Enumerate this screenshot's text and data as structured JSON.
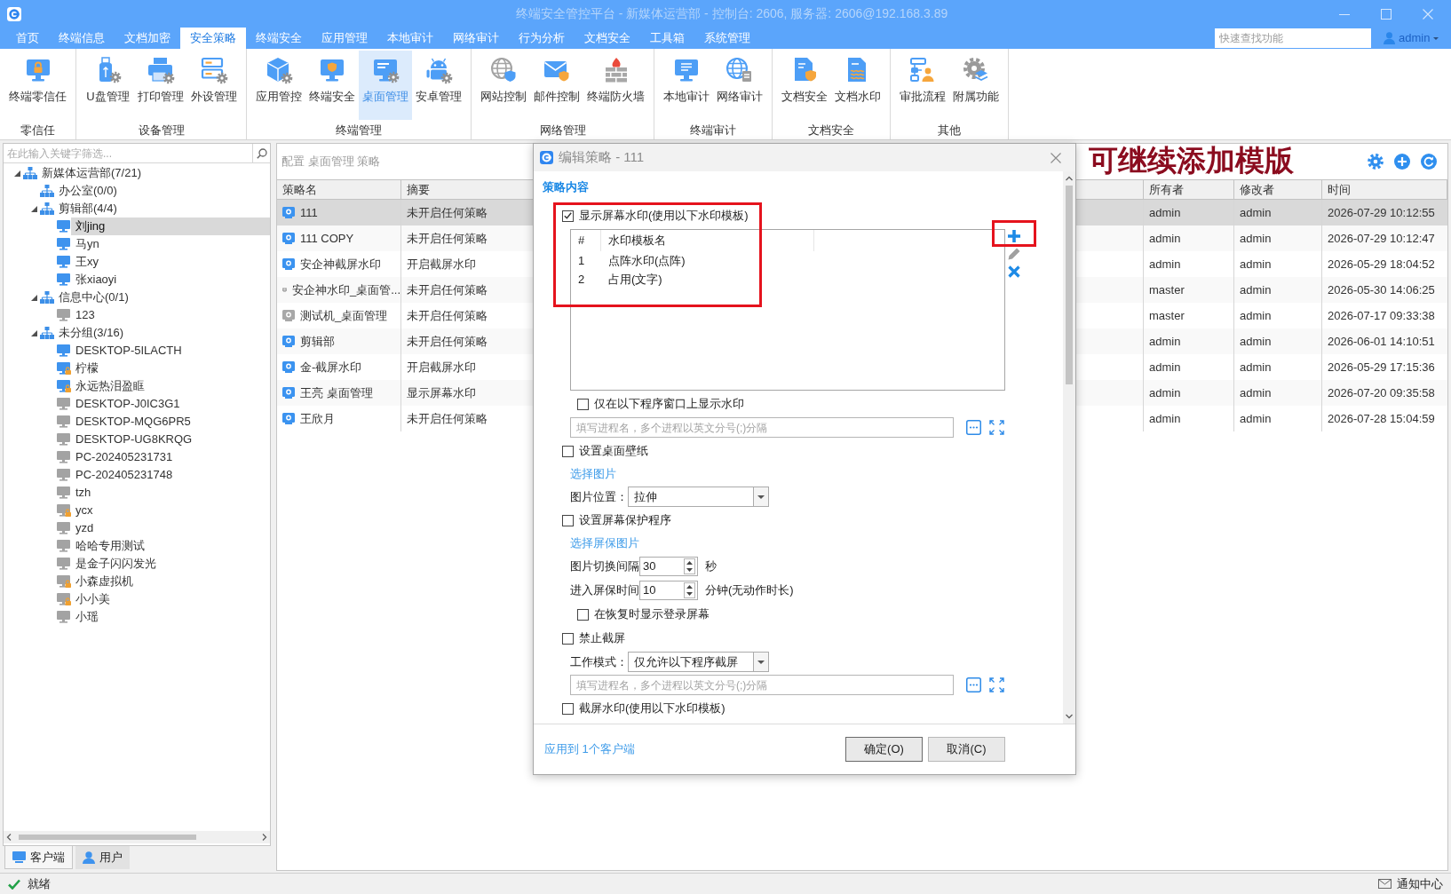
{
  "window": {
    "title": "终端安全管控平台 - 新媒体运营部 - 控制台: 2606, 服务器: 2606@192.168.3.89"
  },
  "menu_tabs": [
    {
      "label": "首页",
      "selected": false
    },
    {
      "label": "终端信息",
      "selected": false
    },
    {
      "label": "文档加密",
      "selected": false
    },
    {
      "label": "安全策略",
      "selected": true
    },
    {
      "label": "终端安全",
      "selected": false
    },
    {
      "label": "应用管理",
      "selected": false
    },
    {
      "label": "本地审计",
      "selected": false
    },
    {
      "label": "网络审计",
      "selected": false
    },
    {
      "label": "行为分析",
      "selected": false
    },
    {
      "label": "文档安全",
      "selected": false
    },
    {
      "label": "工具箱",
      "selected": false
    },
    {
      "label": "系统管理",
      "selected": false
    }
  ],
  "quick_search": {
    "placeholder": "快速查找功能"
  },
  "user": {
    "name": "admin"
  },
  "ribbon": {
    "groups": [
      {
        "label": "零信任",
        "items": [
          {
            "label": "终端零信任",
            "selected": false
          }
        ]
      },
      {
        "label": "设备管理",
        "items": [
          {
            "label": "U盘管理",
            "selected": false
          },
          {
            "label": "打印管理",
            "selected": false
          },
          {
            "label": "外设管理",
            "selected": false
          }
        ]
      },
      {
        "label": "终端管理",
        "items": [
          {
            "label": "应用管控",
            "selected": false
          },
          {
            "label": "终端安全",
            "selected": false
          },
          {
            "label": "桌面管理",
            "selected": true
          },
          {
            "label": "安卓管理",
            "selected": false
          }
        ]
      },
      {
        "label": "网络管理",
        "items": [
          {
            "label": "网站控制",
            "selected": false
          },
          {
            "label": "邮件控制",
            "selected": false
          },
          {
            "label": "终端防火墙",
            "selected": false
          }
        ]
      },
      {
        "label": "终端审计",
        "items": [
          {
            "label": "本地审计",
            "selected": false
          },
          {
            "label": "网络审计",
            "selected": false
          }
        ]
      },
      {
        "label": "文档安全",
        "items": [
          {
            "label": "文档安全",
            "selected": false
          },
          {
            "label": "文档水印",
            "selected": false
          }
        ]
      },
      {
        "label": "其他",
        "items": [
          {
            "label": "审批流程",
            "selected": false
          },
          {
            "label": "附属功能",
            "selected": false
          }
        ]
      }
    ]
  },
  "tree_filter": {
    "placeholder": "在此输入关键字筛选..."
  },
  "tree": [
    {
      "kind": "group",
      "label": "新媒体运营部(7/21)",
      "expanded": true,
      "selected": false,
      "children": [
        {
          "kind": "group",
          "label": "办公室(0/0)",
          "selected": false
        },
        {
          "kind": "group",
          "label": "剪辑部(4/4)",
          "expanded": true,
          "selected": false,
          "children": [
            {
              "kind": "client",
              "label": "刘jing",
              "online": true,
              "locked": false,
              "selected": true
            },
            {
              "kind": "client",
              "label": "马yn",
              "online": true,
              "locked": false,
              "selected": false
            },
            {
              "kind": "client",
              "label": "王xy",
              "online": true,
              "locked": false,
              "selected": false
            },
            {
              "kind": "client",
              "label": "张xiaoyi",
              "online": true,
              "locked": false,
              "selected": false
            }
          ]
        },
        {
          "kind": "group",
          "label": "信息中心(0/1)",
          "expanded": true,
          "selected": false,
          "children": [
            {
              "kind": "client",
              "label": "123",
              "online": false,
              "locked": false,
              "selected": false
            }
          ]
        },
        {
          "kind": "group",
          "label": "未分组(3/16)",
          "expanded": true,
          "selected": false,
          "children": [
            {
              "kind": "client",
              "label": "DESKTOP-5ILACTH",
              "online": true,
              "locked": false,
              "selected": false
            },
            {
              "kind": "client",
              "label": "柠檬",
              "online": true,
              "locked": true,
              "selected": false
            },
            {
              "kind": "client",
              "label": "永远热泪盈眶",
              "online": true,
              "locked": true,
              "selected": false
            },
            {
              "kind": "client",
              "label": "DESKTOP-J0IC3G1",
              "online": false,
              "locked": false,
              "selected": false
            },
            {
              "kind": "client",
              "label": "DESKTOP-MQG6PR5",
              "online": false,
              "locked": false,
              "selected": false
            },
            {
              "kind": "client",
              "label": "DESKTOP-UG8KRQG",
              "online": false,
              "locked": false,
              "selected": false
            },
            {
              "kind": "client",
              "label": "PC-202405231731",
              "online": false,
              "locked": false,
              "selected": false
            },
            {
              "kind": "client",
              "label": "PC-202405231748",
              "online": false,
              "locked": false,
              "selected": false
            },
            {
              "kind": "client",
              "label": "tzh",
              "online": false,
              "locked": false,
              "selected": false
            },
            {
              "kind": "client",
              "label": "ycx",
              "online": false,
              "locked": true,
              "selected": false
            },
            {
              "kind": "client",
              "label": "yzd",
              "online": false,
              "locked": false,
              "selected": false
            },
            {
              "kind": "client",
              "label": "哈哈专用测试",
              "online": false,
              "locked": false,
              "selected": false
            },
            {
              "kind": "client",
              "label": "是金子闪闪发光",
              "online": false,
              "locked": false,
              "selected": false
            },
            {
              "kind": "client",
              "label": "小森虚拟机",
              "online": false,
              "locked": true,
              "selected": false
            },
            {
              "kind": "client",
              "label": "小小美",
              "online": false,
              "locked": true,
              "selected": false
            },
            {
              "kind": "client",
              "label": "小瑶",
              "online": false,
              "locked": false,
              "selected": false
            }
          ]
        }
      ]
    }
  ],
  "left_tabs": [
    {
      "label": "客户端",
      "selected": true
    },
    {
      "label": "用户",
      "selected": false
    }
  ],
  "policy_panel": {
    "breadcrumb": "配置 桌面管理 策略",
    "columns": [
      "策略名",
      "摘要",
      "所有者",
      "修改者",
      "时间"
    ],
    "rows": [
      {
        "name": "111",
        "summary": "未开启任何策略",
        "owner": "admin",
        "modifier": "admin",
        "time": "2026-07-29 10:12:55",
        "enabled": true,
        "selected": true
      },
      {
        "name": "111 COPY",
        "summary": "未开启任何策略",
        "owner": "admin",
        "modifier": "admin",
        "time": "2026-07-29 10:12:47",
        "enabled": true,
        "selected": false
      },
      {
        "name": "安企神截屏水印",
        "summary": "开启截屏水印",
        "owner": "admin",
        "modifier": "admin",
        "time": "2026-05-29 18:04:52",
        "enabled": true,
        "selected": false
      },
      {
        "name": "安企神水印_桌面管...",
        "summary": "未开启任何策略",
        "owner": "master",
        "modifier": "admin",
        "time": "2026-05-30 14:06:25",
        "enabled": false,
        "selected": false
      },
      {
        "name": "测试机_桌面管理",
        "summary": "未开启任何策略",
        "owner": "master",
        "modifier": "admin",
        "time": "2026-07-17 09:33:38",
        "enabled": false,
        "selected": false
      },
      {
        "name": "剪辑部",
        "summary": "未开启任何策略",
        "owner": "admin",
        "modifier": "admin",
        "time": "2026-06-01 14:10:51",
        "enabled": true,
        "selected": false
      },
      {
        "name": "金-截屏水印",
        "summary": "开启截屏水印",
        "owner": "admin",
        "modifier": "admin",
        "time": "2026-05-29 17:15:36",
        "enabled": true,
        "selected": false
      },
      {
        "name": "王亮 桌面管理",
        "summary": "显示屏幕水印",
        "owner": "admin",
        "modifier": "admin",
        "time": "2026-07-20 09:35:58",
        "enabled": true,
        "selected": false
      },
      {
        "name": "王欣月",
        "summary": "未开启任何策略",
        "owner": "admin",
        "modifier": "admin",
        "time": "2026-07-28 15:04:59",
        "enabled": true,
        "selected": false
      }
    ]
  },
  "dialog": {
    "title": "编辑策略 - 111",
    "section": "策略内容",
    "settings": [
      {
        "kind": "checkbox",
        "label": "显示屏幕水印(使用以下水印模板)",
        "checked": true,
        "children": [
          {
            "kind": "template_list",
            "columns": [
              "#",
              "水印模板名"
            ],
            "rows": [
              {
                "index": "1",
                "name": "点阵水印(点阵)"
              },
              {
                "index": "2",
                "name": "占用(文字)"
              }
            ]
          },
          {
            "kind": "checkbox",
            "label": "仅在以下程序窗口上显示水印",
            "checked": false
          },
          {
            "kind": "process_field",
            "placeholder": "填写进程名，多个进程以英文分号(;)分隔"
          }
        ]
      },
      {
        "kind": "checkbox",
        "label": "设置桌面壁纸",
        "checked": false,
        "children": [
          {
            "kind": "link",
            "label": "选择图片"
          },
          {
            "kind": "select",
            "label": "图片位置：",
            "value": "拉伸"
          }
        ]
      },
      {
        "kind": "checkbox",
        "label": "设置屏幕保护程序",
        "checked": false,
        "children": [
          {
            "kind": "link",
            "label": "选择屏保图片"
          },
          {
            "kind": "spinner",
            "label": "图片切换间隔",
            "value": "30",
            "unit": "秒"
          },
          {
            "kind": "spinner",
            "label": "进入屏保时间",
            "value": "10",
            "unit": "分钟(无动作时长)"
          },
          {
            "kind": "checkbox",
            "label": "在恢复时显示登录屏幕",
            "checked": false
          }
        ]
      },
      {
        "kind": "checkbox",
        "label": "禁止截屏",
        "checked": false,
        "children": [
          {
            "kind": "select",
            "label": "工作模式：",
            "value": "仅允许以下程序截屏"
          },
          {
            "kind": "process_field",
            "placeholder": "填写进程名，多个进程以英文分号(;)分隔"
          }
        ]
      },
      {
        "kind": "checkbox",
        "label": "截屏水印(使用以下水印模板)",
        "checked": false
      }
    ],
    "apply_link": "应用到 1个客户端",
    "buttons": [
      {
        "label": "确定(O)",
        "default": true
      },
      {
        "label": "取消(C)",
        "default": false
      }
    ]
  },
  "annotation": {
    "text": "可继续添加模版"
  },
  "status_bar": {
    "status": "就绪",
    "notifications": "通知中心"
  }
}
